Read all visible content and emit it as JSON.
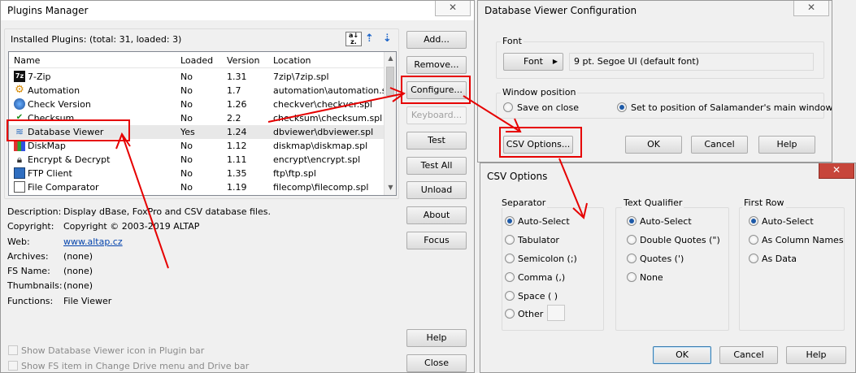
{
  "plugins_manager": {
    "title": "Plugins Manager",
    "installed_label": "Installed Plugins: (total: 31, loaded: 3)",
    "columns": [
      "Name",
      "Loaded",
      "Version",
      "Location"
    ],
    "rows": [
      {
        "name": "7-Zip",
        "loaded": "No",
        "version": "1.31",
        "location": "7zip\\7zip.spl",
        "icon": "7zip-icon"
      },
      {
        "name": "Automation",
        "loaded": "No",
        "version": "1.7",
        "location": "automation\\automation.spl",
        "icon": "automation-icon"
      },
      {
        "name": "Check Version",
        "loaded": "No",
        "version": "1.26",
        "location": "checkver\\checkver.spl",
        "icon": "globe-icon"
      },
      {
        "name": "Checksum",
        "loaded": "No",
        "version": "2.2",
        "location": "checksum\\checksum.spl",
        "icon": "checksum-icon"
      },
      {
        "name": "Database Viewer",
        "loaded": "Yes",
        "version": "1.24",
        "location": "dbviewer\\dbviewer.spl",
        "icon": "database-icon"
      },
      {
        "name": "DiskMap",
        "loaded": "No",
        "version": "1.12",
        "location": "diskmap\\diskmap.spl",
        "icon": "diskmap-icon"
      },
      {
        "name": "Encrypt & Decrypt",
        "loaded": "No",
        "version": "1.11",
        "location": "encrypt\\encrypt.spl",
        "icon": "lock-icon"
      },
      {
        "name": "FTP Client",
        "loaded": "No",
        "version": "1.35",
        "location": "ftp\\ftp.spl",
        "icon": "ftp-icon"
      },
      {
        "name": "File Comparator",
        "loaded": "No",
        "version": "1.19",
        "location": "filecomp\\filecomp.spl",
        "icon": "filecomp-icon"
      }
    ],
    "details": {
      "description_label": "Description:",
      "description": "Display dBase, FoxPro and CSV database files.",
      "copyright_label": "Copyright:",
      "copyright": "Copyright © 2003-2019 ALTAP",
      "web_label": "Web:",
      "web": "www.altap.cz",
      "archives_label": "Archives:",
      "archives": "(none)",
      "fsname_label": "FS Name:",
      "fsname": "(none)",
      "thumbnails_label": "Thumbnails:",
      "thumbnails": "(none)",
      "functions_label": "Functions:",
      "functions": "File Viewer"
    },
    "checkboxes": {
      "show_icon": "Show Database Viewer icon in Plugin bar",
      "show_fs": "Show FS item in Change Drive menu and Drive bar"
    },
    "buttons": {
      "add": "Add...",
      "remove": "Remove...",
      "configure": "Configure...",
      "keyboard": "Keyboard...",
      "test": "Test",
      "test_all": "Test All",
      "unload": "Unload",
      "about": "About",
      "focus": "Focus",
      "help": "Help",
      "close": "Close"
    },
    "sort_icons": [
      "a-z-sort-icon",
      "move-up-icon",
      "move-down-icon"
    ]
  },
  "db_config": {
    "title": "Database Viewer Configuration",
    "font_group": "Font",
    "font_button": "Font",
    "font_value": "9 pt. Segoe UI (default font)",
    "position_group": "Window position",
    "save_on_close": "Save on close",
    "set_position": "Set to position of Salamander's main window",
    "selected_position": "set_position",
    "csv_options_button": "CSV Options...",
    "ok": "OK",
    "cancel": "Cancel",
    "help": "Help"
  },
  "csv_options": {
    "title": "CSV Options",
    "separator": {
      "title": "Separator",
      "options": [
        "Auto-Select",
        "Tabulator",
        "Semicolon (;)",
        "Comma (,)",
        "Space ( )",
        "Other"
      ],
      "selected": "Auto-Select"
    },
    "text_qualifier": {
      "title": "Text Qualifier",
      "options": [
        "Auto-Select",
        "Double Quotes (\")",
        "Quotes (')",
        "None"
      ],
      "selected": "Auto-Select"
    },
    "first_row": {
      "title": "First Row",
      "options": [
        "Auto-Select",
        "As Column Names",
        "As Data"
      ],
      "selected": "Auto-Select"
    },
    "ok": "OK",
    "cancel": "Cancel",
    "help": "Help"
  },
  "colors": {
    "annotation": "#e60000",
    "selection": "#e8e8e8",
    "link": "#0645ad"
  }
}
